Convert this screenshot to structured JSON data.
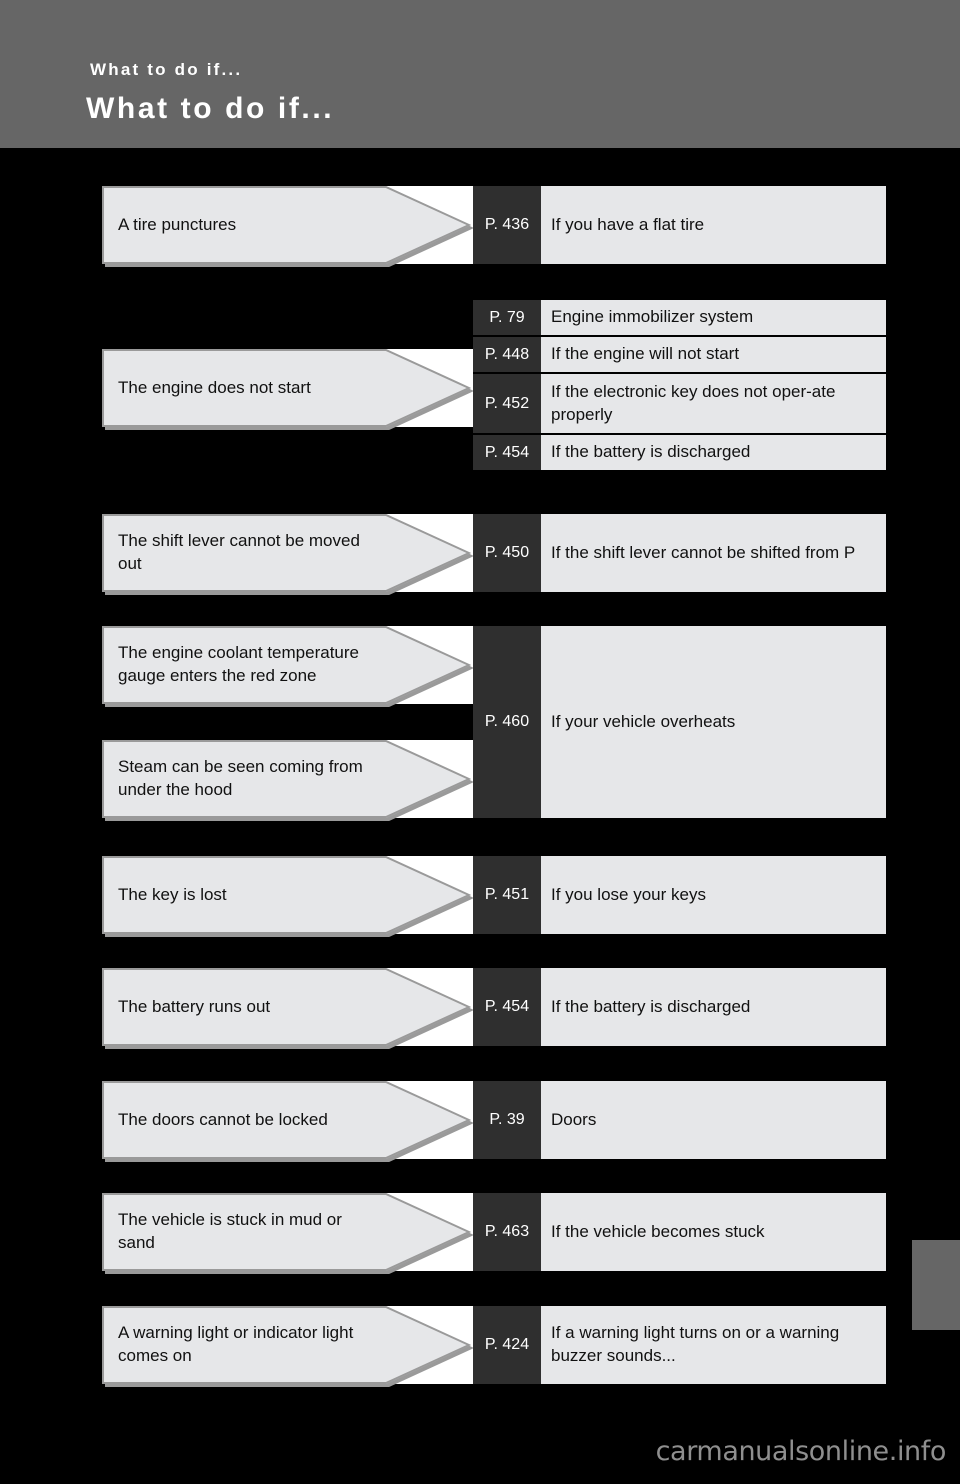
{
  "header": {
    "kicker": "What to do if...",
    "title": "What to do if...",
    "bg_color": "#666666",
    "text_color": "#ffffff"
  },
  "colors": {
    "page_background": "#000000",
    "callout_fill": "#e6e7e9",
    "callout_border": "#9a9a9a",
    "page_chip_bg": "#2f2f2f",
    "page_chip_text": "#ffffff",
    "description_bg": "#e6e7e9",
    "body_text": "#111111",
    "side_tab": "#666666",
    "watermark": "#8f8f8f"
  },
  "rows": [
    {
      "symptom": "A tire punctures",
      "entries": [
        {
          "page": "P. 436",
          "description": "If you have a flat tire"
        }
      ]
    },
    {
      "symptom": "The engine does not start",
      "entries": [
        {
          "page": "P. 79",
          "description": "Engine immobilizer system"
        },
        {
          "page": "P. 448",
          "description": "If the engine will not start"
        },
        {
          "page": "P. 452",
          "description": "If the electronic key does not oper-​ate properly"
        },
        {
          "page": "P. 454",
          "description": "If the battery is discharged"
        }
      ]
    },
    {
      "symptom": "The shift lever cannot be moved out",
      "entries": [
        {
          "page": "P. 450",
          "description": "If the shift lever cannot be shifted from P"
        }
      ]
    },
    {
      "symptom": "The engine coolant temperature gauge enters the red zone",
      "symptom2": "Steam can be seen coming from under the hood",
      "entries": [
        {
          "page": "P. 460",
          "description": "If your vehicle overheats"
        }
      ]
    },
    {
      "symptom": "The key is lost",
      "entries": [
        {
          "page": "P. 451",
          "description": "If you lose your keys"
        }
      ]
    },
    {
      "symptom": "The battery runs out",
      "entries": [
        {
          "page": "P. 454",
          "description": "If the battery is discharged"
        }
      ]
    },
    {
      "symptom": "The doors cannot be locked",
      "entries": [
        {
          "page": "P. 39",
          "description": "Doors"
        }
      ]
    },
    {
      "symptom": "The vehicle is stuck in mud or sand",
      "entries": [
        {
          "page": "P. 463",
          "description": "If the vehicle becomes stuck"
        }
      ]
    },
    {
      "symptom": "A warning light or indicator light comes on",
      "entries": [
        {
          "page": "P. 424",
          "description": "If a warning light turns on or a warning buzzer sounds..."
        }
      ]
    }
  ],
  "watermark": "carmanualsonline.info"
}
